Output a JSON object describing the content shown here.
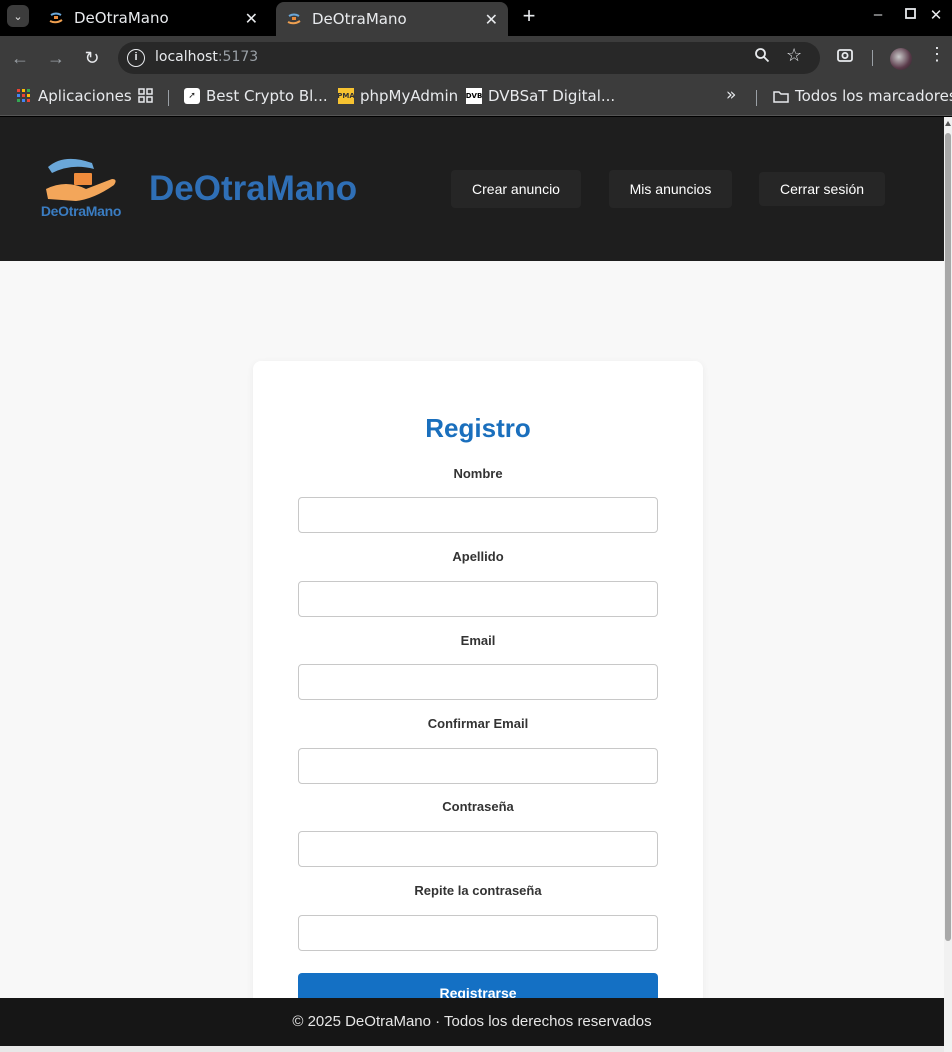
{
  "browser": {
    "tabs": [
      {
        "title": "DeOtraMano",
        "active": false
      },
      {
        "title": "DeOtraMano",
        "active": true
      }
    ],
    "url_host": "localhost",
    "url_port": ":5173",
    "bookmarks": {
      "apps": "Aplicaciones",
      "crypto": "Best Crypto Bl...",
      "phpmyadmin": "phpMyAdmin",
      "dvb": "DVBSaT Digital...",
      "overflow": "»",
      "all": "Todos los marcadores"
    }
  },
  "site": {
    "logo_text": "DeOtraMano",
    "brand": "DeOtraMano",
    "nav": {
      "create": "Crear anuncio",
      "mine": "Mis anuncios",
      "logout": "Cerrar sesión"
    }
  },
  "form": {
    "title": "Registro",
    "fields": [
      {
        "label": "Nombre",
        "value": ""
      },
      {
        "label": "Apellido",
        "value": ""
      },
      {
        "label": "Email",
        "value": ""
      },
      {
        "label": "Confirmar Email",
        "value": ""
      },
      {
        "label": "Contraseña",
        "value": ""
      },
      {
        "label": "Repite la contraseña",
        "value": ""
      }
    ],
    "submit": "Registrarse"
  },
  "footer": {
    "text": "© 2025 DeOtraMano · Todos los derechos reservados"
  },
  "colors": {
    "brand_blue": "#2f6fb6",
    "primary_button": "#1470c4",
    "header_bg": "#1e1e1e"
  }
}
